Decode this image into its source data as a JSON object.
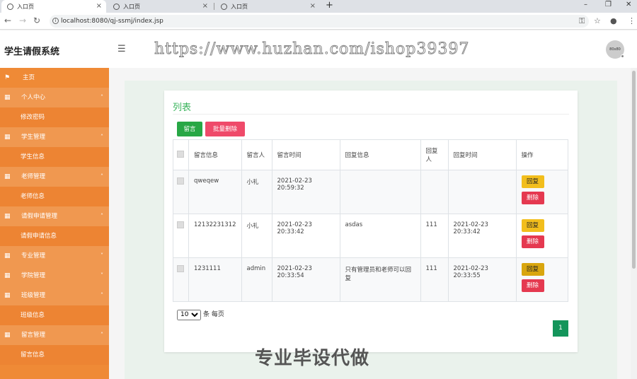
{
  "browser": {
    "tabs": [
      {
        "label": "入口页"
      },
      {
        "label": "入口页"
      },
      {
        "label": "入口页"
      }
    ],
    "url": "localhost:8080/qj-ssmj/index.jsp"
  },
  "header": {
    "brand": "学生请假系统",
    "watermark": "https://www.huzhan.com/ishop39397",
    "avatar_text": "80x80"
  },
  "sidebar": {
    "items": [
      {
        "label": "主页",
        "icon": "flag-icon",
        "type": "home"
      },
      {
        "label": "个人中心",
        "icon": "grid-icon",
        "type": "group"
      },
      {
        "label": "修改密码",
        "type": "sub"
      },
      {
        "label": "学生管理",
        "icon": "grid-icon",
        "type": "group"
      },
      {
        "label": "学生信息",
        "type": "sub"
      },
      {
        "label": "老师管理",
        "icon": "grid-icon",
        "type": "group"
      },
      {
        "label": "老师信息",
        "type": "sub"
      },
      {
        "label": "请假申请管理",
        "icon": "grid-icon",
        "type": "group"
      },
      {
        "label": "请假申请信息",
        "type": "sub"
      },
      {
        "label": "专业管理",
        "icon": "grid-icon",
        "type": "group"
      },
      {
        "label": "学院管理",
        "icon": "grid-icon",
        "type": "group"
      },
      {
        "label": "班级管理",
        "icon": "grid-icon",
        "type": "group"
      },
      {
        "label": "班级信息",
        "type": "sub"
      },
      {
        "label": "留言管理",
        "icon": "grid-icon",
        "type": "group"
      },
      {
        "label": "留言信息",
        "type": "sub"
      }
    ]
  },
  "main": {
    "title": "列表",
    "add_label": "留言",
    "batch_delete_label": "批量删除",
    "columns": [
      "留言信息",
      "留言人",
      "留言时间",
      "回复信息",
      "回复人",
      "回复时间",
      "操作"
    ],
    "rows": [
      {
        "message": "qweqew",
        "author": "小礼",
        "time": "2021-02-23 20:59:32",
        "reply": "",
        "replier": "",
        "reply_time": ""
      },
      {
        "message": "12132231312",
        "author": "小礼",
        "time": "2021-02-23 20:33:42",
        "reply": "asdas",
        "replier": "111",
        "reply_time": "2021-02-23 20:33:42"
      },
      {
        "message": "1231111",
        "author": "admin",
        "time": "2021-02-23 20:33:54",
        "reply": "只有管理员和老师可以回复",
        "replier": "111",
        "reply_time": "2021-02-23 20:33:55"
      }
    ],
    "reply_label": "回复",
    "delete_label": "删除",
    "page_size": "10",
    "page_size_suffix": "条 每页",
    "current_page": "1"
  },
  "overlay_text": "专业毕设代做",
  "colors": {
    "sidebar": "#ef8a36",
    "title": "#3ab45c",
    "add_button": "#28a745",
    "batch_delete_button": "#ef4a6a",
    "reply_button": "#f2be1c",
    "delete_button": "#e53950",
    "pagination": "#14955b"
  }
}
